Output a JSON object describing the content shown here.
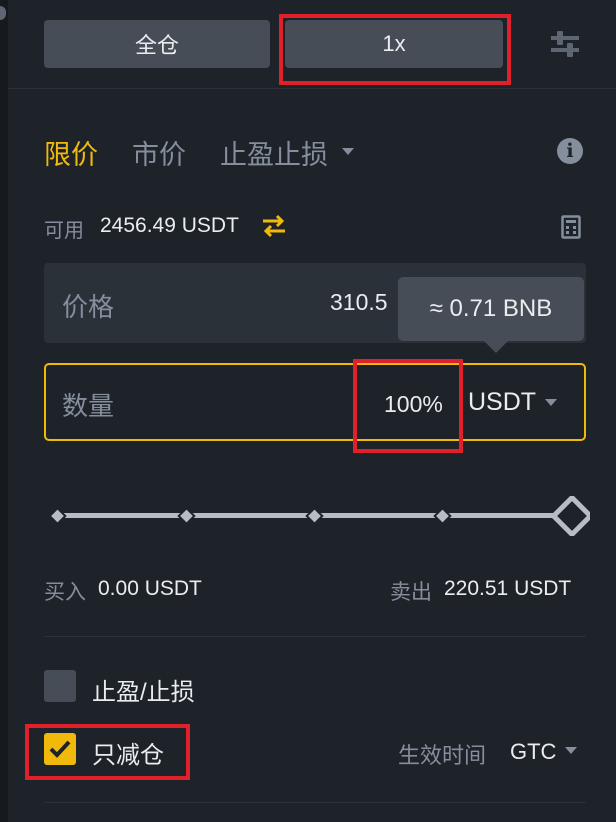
{
  "header": {
    "margin_mode": "全仓",
    "leverage": "1x",
    "settings_icon": "sliders-icon"
  },
  "order_tabs": {
    "limit": "限价",
    "market": "市价",
    "tpsl": "止盈止损",
    "active": "限价",
    "info_icon": "info-icon"
  },
  "available": {
    "label": "可用",
    "value": "2456.49 USDT",
    "transfer_icon": "transfer-arrows-icon",
    "calculator_icon": "calculator-icon"
  },
  "price_field": {
    "label": "价格",
    "value": "310.5"
  },
  "tooltip": {
    "text": "≈ 0.71 BNB"
  },
  "quantity_field": {
    "label": "数量",
    "value": "100%",
    "unit": "USDT"
  },
  "slider": {
    "level": 1.0,
    "marks": [
      0,
      0.25,
      0.5,
      0.75,
      1.0
    ]
  },
  "summary": {
    "buy_label": "买入",
    "buy_value": "0.00 USDT",
    "sell_label": "卖出",
    "sell_value": "220.51 USDT"
  },
  "options": {
    "tpsl_label": "止盈/止损",
    "tpsl_checked": false,
    "reduce_only_label": "只减仓",
    "reduce_only_checked": true,
    "time_in_force_label": "生效时间",
    "time_in_force_value": "GTC"
  },
  "colors": {
    "background": "#1e2329",
    "accent": "#f0b90b",
    "muted_text": "#848e9c",
    "highlight_box": "#e0212b"
  }
}
